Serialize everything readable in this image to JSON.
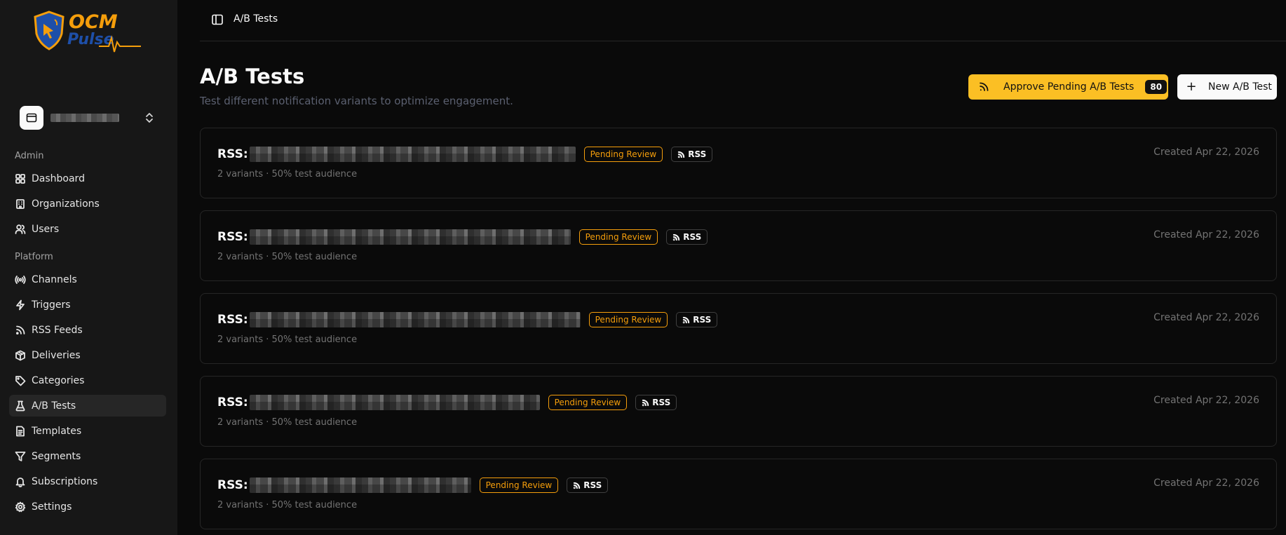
{
  "app": {
    "logo_line1": "OCM",
    "logo_line2": "Pulse"
  },
  "header": {
    "breadcrumb": "A/B Tests"
  },
  "sidebar": {
    "sections": [
      {
        "label": "Admin"
      },
      {
        "label": "Platform"
      }
    ],
    "items": [
      {
        "label": "Dashboard",
        "icon": "grid-icon"
      },
      {
        "label": "Organizations",
        "icon": "building-icon"
      },
      {
        "label": "Users",
        "icon": "users-icon"
      },
      {
        "label": "Channels",
        "icon": "broadcast-icon"
      },
      {
        "label": "Triggers",
        "icon": "zap-icon"
      },
      {
        "label": "RSS Feeds",
        "icon": "rss-icon"
      },
      {
        "label": "Deliveries",
        "icon": "package-icon"
      },
      {
        "label": "Categories",
        "icon": "tag-icon"
      },
      {
        "label": "A/B Tests",
        "icon": "flask-icon",
        "active": true
      },
      {
        "label": "Templates",
        "icon": "file-icon"
      },
      {
        "label": "Segments",
        "icon": "filter-icon"
      },
      {
        "label": "Subscriptions",
        "icon": "bell-icon"
      },
      {
        "label": "Settings",
        "icon": "gear-icon"
      }
    ]
  },
  "page": {
    "title": "A/B Tests",
    "subtitle": "Test different notification variants to optimize engagement.",
    "approve_label": "Approve Pending A/B Tests",
    "approve_count": "80",
    "new_label": "New A/B Test"
  },
  "tests": [
    {
      "prefix": "RSS:",
      "status": "Pending Review",
      "source": "RSS",
      "meta": "2 variants · 50% test audience",
      "created": "Created Apr 22, 2026"
    },
    {
      "prefix": "RSS:",
      "status": "Pending Review",
      "source": "RSS",
      "meta": "2 variants · 50% test audience",
      "created": "Created Apr 22, 2026"
    },
    {
      "prefix": "RSS:",
      "status": "Pending Review",
      "source": "RSS",
      "meta": "2 variants · 50% test audience",
      "created": "Created Apr 22, 2026"
    },
    {
      "prefix": "RSS:",
      "status": "Pending Review",
      "source": "RSS",
      "meta": "2 variants · 50% test audience",
      "created": "Created Apr 22, 2026"
    },
    {
      "prefix": "RSS:",
      "status": "Pending Review",
      "source": "RSS",
      "meta": "2 variants · 50% test audience",
      "created": "Created Apr 22, 2026"
    }
  ],
  "colors": {
    "accent": "#fbbf24",
    "pending": "#f59e0b",
    "background": "#0a0a0a",
    "sidebar": "#171717"
  }
}
